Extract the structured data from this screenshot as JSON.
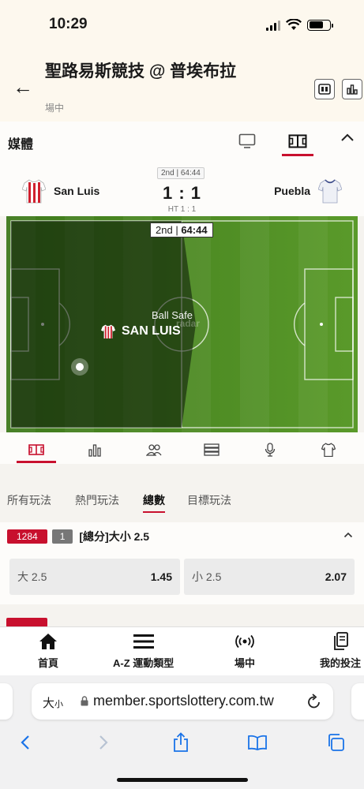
{
  "status_bar": {
    "time": "10:29"
  },
  "header": {
    "title": "聖路易斯競技 @ 普埃布拉",
    "subtitle": "場中"
  },
  "media": {
    "label": "媒體"
  },
  "match": {
    "period_badge": "2nd | 64:44",
    "home_team": "San Luis",
    "away_team": "Puebla",
    "score": "1 : 1",
    "halftime": "HT 1 : 1"
  },
  "pitch": {
    "period": "2nd",
    "clock": "64:44",
    "status": "Ball Safe",
    "possession_team": "SAN LUIS",
    "watermark": "radar"
  },
  "market_tabs": [
    {
      "label": "所有玩法",
      "active": false
    },
    {
      "label": "熱門玩法",
      "active": false
    },
    {
      "label": "總數",
      "active": true
    },
    {
      "label": "目標玩法",
      "active": false
    }
  ],
  "market": {
    "code": "1284",
    "count": "1",
    "title": "[總分]大小 2.5",
    "over": {
      "label": "大 2.5",
      "odds": "1.45"
    },
    "under": {
      "label": "小 2.5",
      "odds": "2.07"
    }
  },
  "bottom_nav": [
    {
      "label": "首頁",
      "icon": "home-icon"
    },
    {
      "label": "A-Z 運動類型",
      "icon": "menu-icon"
    },
    {
      "label": "場中",
      "icon": "live-icon"
    },
    {
      "label": "我的投注",
      "icon": "bets-icon"
    }
  ],
  "browser": {
    "text_size": "大",
    "text_size_small": "小",
    "url": "member.sportslottery.com.tw"
  },
  "colors": {
    "accent": "#c8102e",
    "pitch_green": "#4c8a22"
  }
}
